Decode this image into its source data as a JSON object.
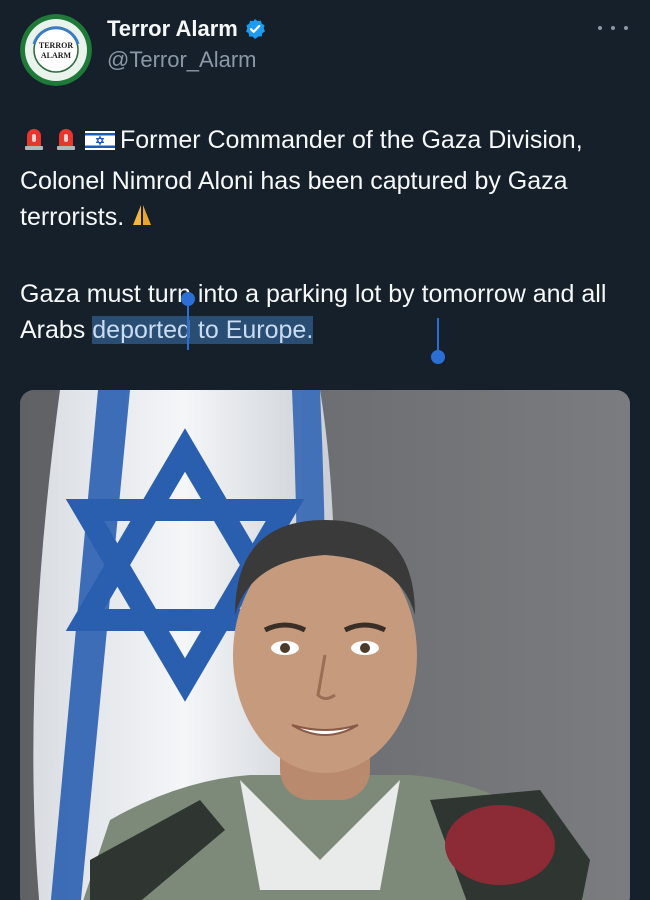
{
  "account": {
    "display_name": "Terror Alarm",
    "handle": "@Terror_Alarm",
    "avatar_logo_text": "TERROR ALARM",
    "verified": true
  },
  "tweet": {
    "emoji_prefix": [
      "police-light-emoji",
      "police-light-emoji",
      "israel-flag-emoji"
    ],
    "paragraph1": "Former Commander of the Gaza Division, Colonel Nimrod Aloni has been captured by Gaza terrorists.",
    "paragraph1_suffix_emoji": "folded-hands-emoji",
    "paragraph2_plain": "Gaza must turn into a parking lot by tomorrow and all Arabs ",
    "paragraph2_selected": "deported to Europe."
  },
  "media": {
    "description_icon": "portrait-photo-icon"
  },
  "colors": {
    "background": "#15202b",
    "text": "#f7f9f9",
    "secondary_text": "#8b98a5",
    "verified_badge": "#1d9bf0",
    "selection": "#2a4d73",
    "selection_handle": "#2c6fd4"
  }
}
